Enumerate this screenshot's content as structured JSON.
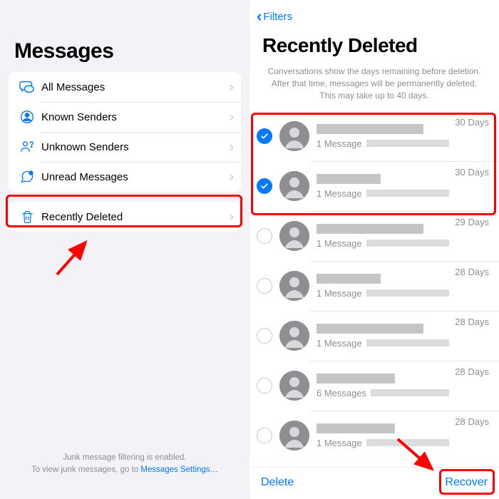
{
  "left": {
    "title": "Messages",
    "filters": [
      {
        "icon": "chat-bubbles-icon",
        "label": "All Messages"
      },
      {
        "icon": "person-circle-icon",
        "label": "Known Senders"
      },
      {
        "icon": "person-question-icon",
        "label": "Unknown Senders"
      },
      {
        "icon": "chat-dot-icon",
        "label": "Unread Messages"
      }
    ],
    "deleted": {
      "icon": "trash-icon",
      "label": "Recently Deleted"
    },
    "footer_line1": "Junk message filtering is enabled.",
    "footer_line2_a": "To view junk messages, go to ",
    "footer_link": "Messages Settings…"
  },
  "right": {
    "back_label": "Filters",
    "title": "Recently Deleted",
    "help": "Conversations show the days remaining before deletion. After that time, messages will be permanently deleted. This may take up to 40 days.",
    "conversations": [
      {
        "selected": true,
        "name_w": 150,
        "count": "1 Message",
        "days": "30 Days"
      },
      {
        "selected": true,
        "name_w": 90,
        "count": "1 Message",
        "days": "30 Days"
      },
      {
        "selected": false,
        "name_w": 150,
        "count": "1 Message",
        "days": "29 Days"
      },
      {
        "selected": false,
        "name_w": 90,
        "count": "1 Message",
        "days": "28 Days"
      },
      {
        "selected": false,
        "name_w": 150,
        "count": "1 Message",
        "days": "28 Days"
      },
      {
        "selected": false,
        "name_w": 110,
        "count": "6 Messages",
        "days": "28 Days"
      },
      {
        "selected": false,
        "name_w": 110,
        "count": "1 Message",
        "days": "28 Days"
      }
    ],
    "delete_label": "Delete",
    "recover_label": "Recover"
  }
}
